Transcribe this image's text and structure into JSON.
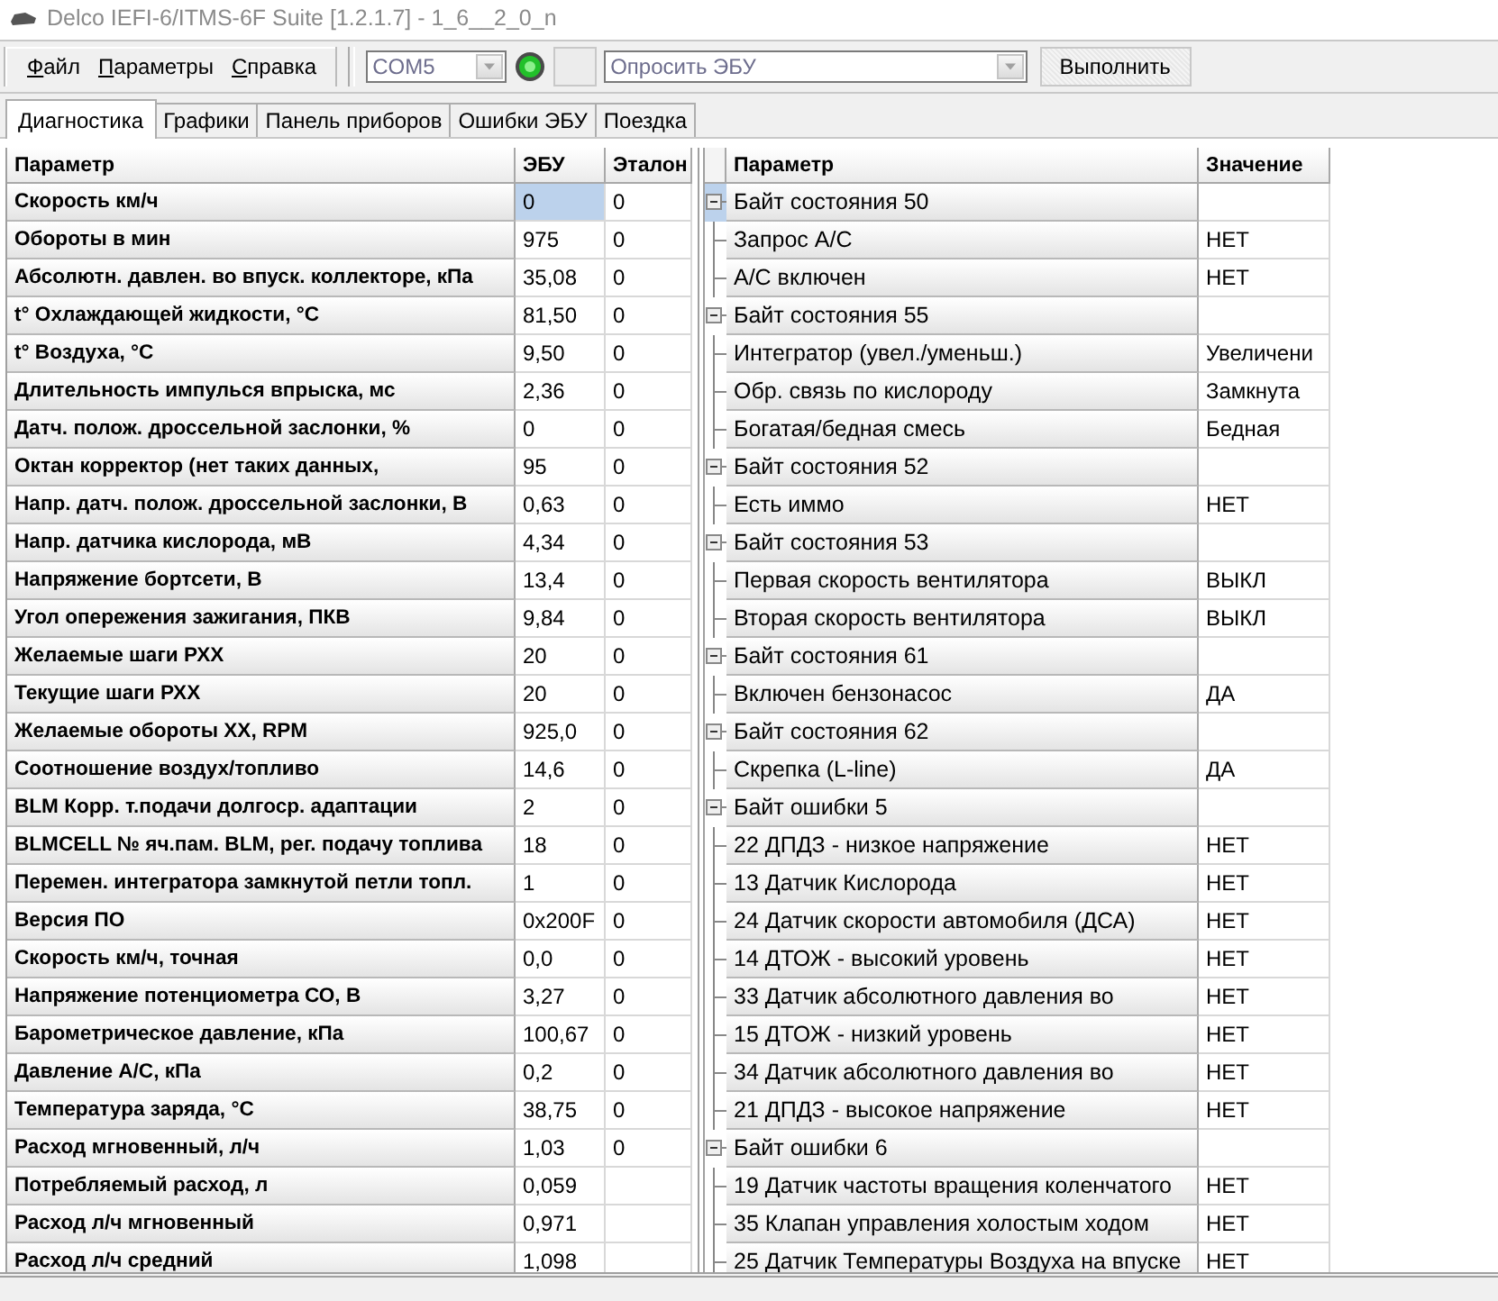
{
  "window": {
    "title": "Delco IEFI-6/ITMS-6F Suite [1.2.1.7] - 1_6__2_0_n"
  },
  "menu": [
    "Файл",
    "Параметры",
    "Справка"
  ],
  "toolbar": {
    "port": {
      "value": "COM5",
      "disabled": true
    },
    "connection_light": {
      "on": true
    },
    "command": {
      "value": "Опросить ЭБУ",
      "disabled": true
    },
    "run_button": "Выполнить"
  },
  "tabs": [
    {
      "label": "Диагностика",
      "selected": true
    },
    {
      "label": "Графики",
      "selected": false
    },
    {
      "label": "Панель приборов",
      "selected": false
    },
    {
      "label": "Ошибки ЭБУ",
      "selected": false
    },
    {
      "label": "Поездка",
      "selected": false
    }
  ],
  "param_table": {
    "columns": [
      "Параметр",
      "ЭБУ",
      "Эталон"
    ],
    "rows": [
      {
        "name": "Скорость км/ч",
        "ecu": "0",
        "reference": "0",
        "selected": true
      },
      {
        "name": "Обороты в мин",
        "ecu": "975",
        "reference": "0",
        "selected": false
      },
      {
        "name": "Абсолютн. давлен. во впуск. коллекторе, кПа",
        "ecu": "35,08",
        "reference": "0",
        "selected": false
      },
      {
        "name": "t° Охлаждающей жидкости, °С",
        "ecu": "81,50",
        "reference": "0",
        "selected": false
      },
      {
        "name": "t° Воздуха, °С",
        "ecu": "9,50",
        "reference": "0",
        "selected": false
      },
      {
        "name": "Длительность импулься впрыска, мс",
        "ecu": "2,36",
        "reference": "0",
        "selected": false
      },
      {
        "name": "Датч. полож. дроссельной заслонки, %",
        "ecu": "0",
        "reference": "0",
        "selected": false
      },
      {
        "name": "Октан корректор (нет таких данных,",
        "ecu": "95",
        "reference": "0",
        "selected": false
      },
      {
        "name": "Напр. датч. полож. дроссельной заслонки, В",
        "ecu": "0,63",
        "reference": "0",
        "selected": false
      },
      {
        "name": "Напр. датчика кислорода, мВ",
        "ecu": "4,34",
        "reference": "0",
        "selected": false
      },
      {
        "name": "Напряжение бортсети, В",
        "ecu": "13,4",
        "reference": "0",
        "selected": false
      },
      {
        "name": "Угол опережения зажигания, ПКВ",
        "ecu": "9,84",
        "reference": "0",
        "selected": false
      },
      {
        "name": "Желаемые шаги РХХ",
        "ecu": "20",
        "reference": "0",
        "selected": false
      },
      {
        "name": "Текущие шаги РХХ",
        "ecu": "20",
        "reference": "0",
        "selected": false
      },
      {
        "name": "Желаемые обороты ХХ, RPM",
        "ecu": "925,0",
        "reference": "0",
        "selected": false
      },
      {
        "name": "Соотношение воздух/топливо",
        "ecu": "14,6",
        "reference": "0",
        "selected": false
      },
      {
        "name": "BLM Корр. т.подачи долгоср. адаптации",
        "ecu": "2",
        "reference": "0",
        "selected": false
      },
      {
        "name": "BLMCELL № яч.пам. BLM, рег. подачу топлива",
        "ecu": "18",
        "reference": "0",
        "selected": false
      },
      {
        "name": "Перемен. интегратора замкнутой петли топл.",
        "ecu": "1",
        "reference": "0",
        "selected": false
      },
      {
        "name": "Версия ПО",
        "ecu": "0x200F",
        "reference": "0",
        "selected": false
      },
      {
        "name": "Скорость км/ч, точная",
        "ecu": "0,0",
        "reference": "0",
        "selected": false
      },
      {
        "name": "Напряжение потенциометра СО, В",
        "ecu": "3,27",
        "reference": "0",
        "selected": false
      },
      {
        "name": "Барометрическое давление, кПа",
        "ecu": "100,67",
        "reference": "0",
        "selected": false
      },
      {
        "name": "Давление A/C, кПа",
        "ecu": "0,2",
        "reference": "0",
        "selected": false
      },
      {
        "name": "Температура заряда, °С",
        "ecu": "38,75",
        "reference": "0",
        "selected": false
      },
      {
        "name": "Расход мгновенный, л/ч",
        "ecu": "1,03",
        "reference": "0",
        "selected": false
      },
      {
        "name": "Потребляемый расход, л",
        "ecu": "0,059",
        "selected": false
      },
      {
        "name": "Расход л/ч мгновенный",
        "ecu": "0,971",
        "selected": false
      },
      {
        "name": "Расход л/ч средний",
        "ecu": "1,098",
        "selected": false
      }
    ]
  },
  "status_tree": {
    "columns": [
      "Параметр",
      "Значение"
    ],
    "groups": [
      {
        "label": "Байт состояния 50",
        "expanded": true,
        "selected": true,
        "children": [
          {
            "label": "Запрос A/C",
            "value": "НЕТ"
          },
          {
            "label": "A/C включен",
            "value": "НЕТ"
          }
        ]
      },
      {
        "label": "Байт состояния 55",
        "expanded": true,
        "selected": false,
        "children": [
          {
            "label": "Интегратор (увел./уменьш.)",
            "value": "Увеличени"
          },
          {
            "label": "Обр. связь по кислороду",
            "value": "Замкнута"
          },
          {
            "label": "Богатая/бедная смесь",
            "value": "Бедная"
          }
        ]
      },
      {
        "label": "Байт состояния 52",
        "expanded": true,
        "selected": false,
        "children": [
          {
            "label": "Есть иммо",
            "value": "НЕТ"
          }
        ]
      },
      {
        "label": "Байт состояния 53",
        "expanded": true,
        "selected": false,
        "children": [
          {
            "label": "Первая скорость вентилятора",
            "value": "ВЫКЛ"
          },
          {
            "label": "Вторая скорость вентилятора",
            "value": "ВЫКЛ"
          }
        ]
      },
      {
        "label": "Байт состояния 61",
        "expanded": true,
        "selected": false,
        "children": [
          {
            "label": "Включен бензонасос",
            "value": "ДА"
          }
        ]
      },
      {
        "label": "Байт состояния 62",
        "expanded": true,
        "selected": false,
        "children": [
          {
            "label": "Скрепка (L-line)",
            "value": "ДА"
          }
        ]
      },
      {
        "label": "Байт ошибки 5",
        "expanded": true,
        "selected": false,
        "children": [
          {
            "label": "22 ДПДЗ - низкое напряжение",
            "value": "НЕТ"
          },
          {
            "label": "13 Датчик Кислорода",
            "value": "НЕТ"
          },
          {
            "label": "24 Датчик скорости автомобиля (ДСА)",
            "value": "НЕТ"
          },
          {
            "label": "14 ДТОЖ - высокий уровень",
            "value": "НЕТ"
          },
          {
            "label": "33 Датчик абсолютного давления во",
            "value": "НЕТ"
          },
          {
            "label": "15 ДТОЖ - низкий уровень",
            "value": "НЕТ"
          },
          {
            "label": "34 Датчик абсолютного давления во",
            "value": "НЕТ"
          },
          {
            "label": "21 ДПДЗ - высокое напряжение",
            "value": "НЕТ"
          }
        ]
      },
      {
        "label": "Байт ошибки 6",
        "expanded": true,
        "selected": false,
        "children": [
          {
            "label": "19 Датчик частоты вращения коленчатого",
            "value": "НЕТ"
          },
          {
            "label": "35 Клапан управления холостым ходом",
            "value": "НЕТ"
          },
          {
            "label": "25 Датчик Температуры Воздуха на впуске",
            "value": "НЕТ"
          }
        ]
      }
    ]
  }
}
